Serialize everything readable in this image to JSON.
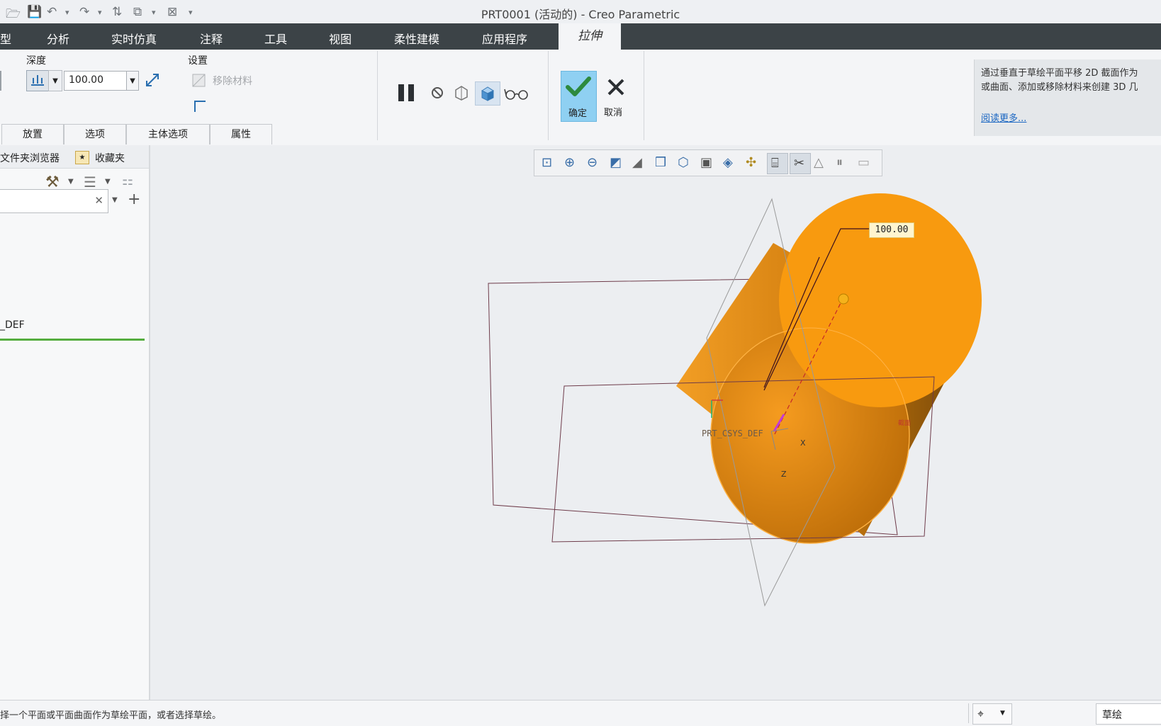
{
  "window": {
    "title": "PRT0001 (活动的) - Creo Parametric"
  },
  "menu": {
    "items": [
      "型",
      "分析",
      "实时仿真",
      "注释",
      "工具",
      "视图",
      "柔性建模",
      "应用程序"
    ],
    "active_tab": "拉伸"
  },
  "ribbon": {
    "depth_label": "深度",
    "depth_value": "100.00",
    "settings_label": "设置",
    "remove_material_label": "移除材料",
    "ok_label": "确定",
    "cancel_label": "取消",
    "help_text_line1": "通过垂直于草绘平面平移 2D 截面作为",
    "help_text_line2": "或曲面、添加或移除材料来创建 3D 几",
    "read_more_link": "阅读更多...",
    "sub_tabs": [
      "放置",
      "选项",
      "主体选项",
      "属性"
    ]
  },
  "left_panel": {
    "tab_folder_browser": "文件夹浏览器",
    "tab_favorites": "收藏夹",
    "tree_item": "_DEF"
  },
  "viewport": {
    "dimension_value": "100.00",
    "csys_label": "PRT_CSYS_DEF",
    "axis_x": "X",
    "axis_z": "Z",
    "section_label": "截面",
    "part_color": "#f79a10"
  },
  "status": {
    "message": "择一个平面或平面曲面作为草绘平面，或者选择草绘。",
    "filter_value": "草绘"
  }
}
